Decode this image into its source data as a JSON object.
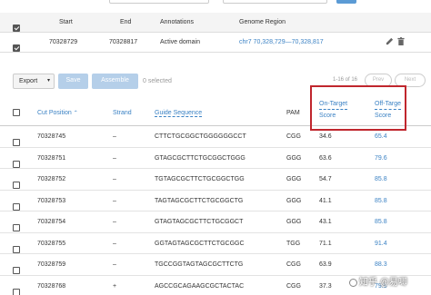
{
  "region_table": {
    "headers": {
      "start": "Start",
      "end": "End",
      "annotations": "Annotations",
      "genome_region": "Genome Region"
    },
    "row": {
      "start": "70328729",
      "end": "70328817",
      "annotation": "Active domain",
      "genome_region": "chr7 70,328,729—70,328,817"
    }
  },
  "toolbar": {
    "export_label": "Export",
    "save_label": "Save",
    "assemble_label": "Assemble",
    "selected_text": "0 selected",
    "page_info": "1-16 of 16",
    "prev_label": "Prev",
    "next_label": "Next"
  },
  "guides_table": {
    "headers": {
      "cut_position": "Cut Position",
      "strand": "Strand",
      "guide_sequence": "Guide Sequence",
      "pam": "PAM",
      "on_target_1": "On-Target",
      "on_target_2": "Score",
      "off_target_1": "Off-Targe",
      "off_target_2": "Score"
    },
    "rows": [
      {
        "cut": "70328745",
        "strand": "–",
        "seq": "CTTCTGCGGCTGGGGGGCCT",
        "pam": "CGG",
        "on": "34.6",
        "off": "65.4"
      },
      {
        "cut": "70328751",
        "strand": "–",
        "seq": "GTAGCGCTTCTGCGGCTGGG",
        "pam": "GGG",
        "on": "63.6",
        "off": "79.6"
      },
      {
        "cut": "70328752",
        "strand": "–",
        "seq": "TGTAGCGCTTCTGCGGCTGG",
        "pam": "GGG",
        "on": "54.7",
        "off": "85.8"
      },
      {
        "cut": "70328753",
        "strand": "–",
        "seq": "TAGTAGCGCTTCTGCGGCTG",
        "pam": "GGG",
        "on": "41.1",
        "off": "85.8"
      },
      {
        "cut": "70328754",
        "strand": "–",
        "seq": "GTAGTAGCGCTTCTGCGGCT",
        "pam": "GGG",
        "on": "43.1",
        "off": "85.8"
      },
      {
        "cut": "70328755",
        "strand": "–",
        "seq": "GGTAGTAGCGCTTCTGCGGC",
        "pam": "TGG",
        "on": "71.1",
        "off": "91.4"
      },
      {
        "cut": "70328759",
        "strand": "–",
        "seq": "TGCCGGTAGTAGCGCTTCTG",
        "pam": "CGG",
        "on": "63.9",
        "off": "88.3"
      },
      {
        "cut": "70328768",
        "strand": "+",
        "seq": "AGCCGCAGAAGCGCTACTAC",
        "pam": "CGG",
        "on": "37.3",
        "off": "79.9"
      }
    ]
  },
  "watermark": "知乎 @易唧",
  "colors": {
    "link": "#3b82c4",
    "highlight_box": "#c0262d",
    "disabled_button": "#b5cfe9"
  }
}
